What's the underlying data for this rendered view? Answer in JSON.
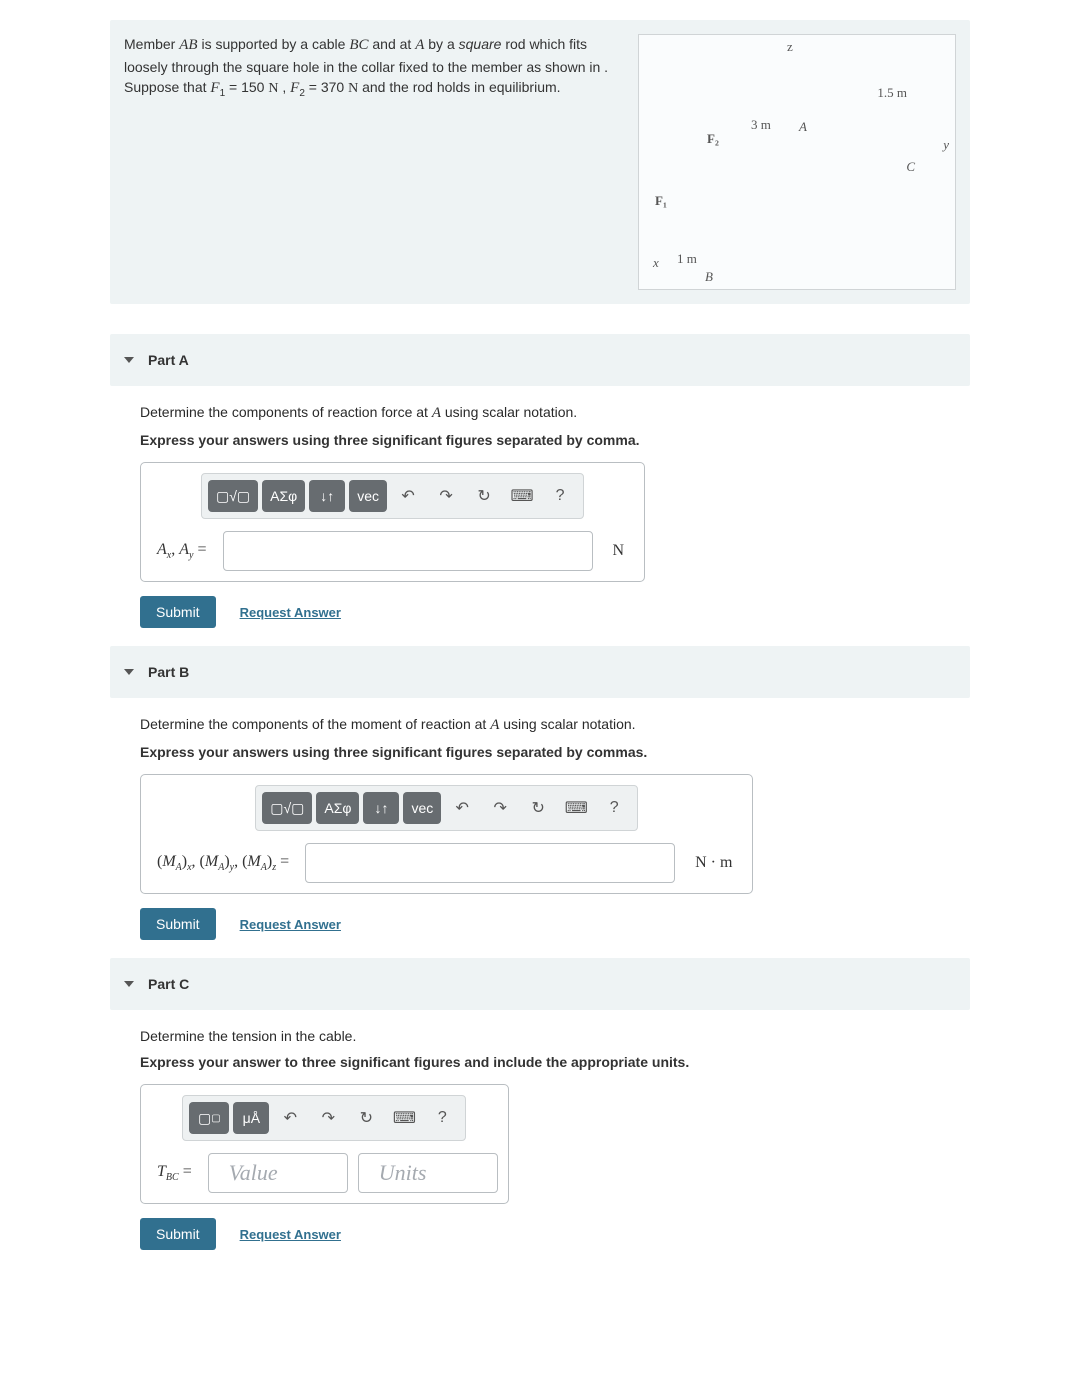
{
  "problem": {
    "intro_1": "Member ",
    "member": "AB",
    "intro_2": " is supported by a cable ",
    "cable": "BC",
    "intro_3": " and at ",
    "pointA": "A",
    "intro_4": " by a ",
    "square": "square",
    "intro_5": " rod which fits loosely through the square hole in the collar fixed to the member as shown in . Suppose that ",
    "F1": "F",
    "F1sub": "1",
    "F1val": " = 150  ",
    "unitN1": "N",
    "comma1": " , ",
    "F2": "F",
    "F2sub": "2",
    "F2val": " = 370  ",
    "unitN2": "N",
    "intro_6": " and the rod holds in equilibrium."
  },
  "diagram": {
    "z": "z",
    "y": "y",
    "x": "x",
    "A": "A",
    "B": "B",
    "C": "C",
    "F1": "F₁",
    "F2": "F₂",
    "d1": "1.5 m",
    "d2": "3 m",
    "d3": "1 m"
  },
  "partA": {
    "title": "Part A",
    "prompt_pre": "Determine the components of reaction force at ",
    "prompt_var": "A",
    "prompt_post": " using scalar notation.",
    "instruct": "Express your answers using three significant figures separated by comma.",
    "varlabel": "Aₓ, Aᵧ = ",
    "unit": "N"
  },
  "partB": {
    "title": "Part B",
    "prompt_pre": "Determine the components of the moment of reaction at ",
    "prompt_var": "A",
    "prompt_post": " using scalar notation.",
    "instruct": "Express your answers using three significant figures separated by commas.",
    "varlabel": "(M_A)ₓ, (M_A)ᵧ, (M_A)_z = ",
    "unit": "N · m"
  },
  "partC": {
    "title": "Part C",
    "prompt": "Determine the tension in the cable.",
    "instruct": "Express your answer to three significant figures and include the appropriate units.",
    "varlabel": "T_BC = ",
    "ph_value": "Value",
    "ph_units": "Units"
  },
  "toolbar": {
    "templates": "▢√▢",
    "greek": "ΑΣφ",
    "subsup": "↓↑",
    "vec": "vec",
    "units_tb": "μÅ"
  },
  "buttons": {
    "submit": "Submit",
    "request": "Request Answer"
  }
}
